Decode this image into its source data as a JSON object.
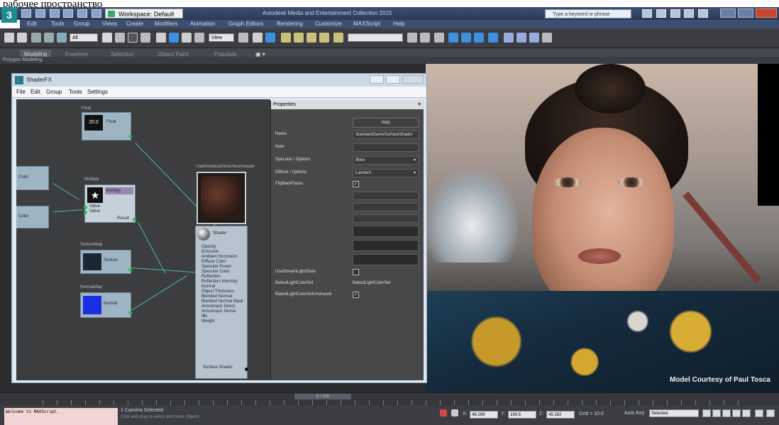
{
  "top_text": "рабочее пространство",
  "titlebar": {
    "workspace_label": "Workspace: Default",
    "app_title": "Autodesk Media and Entertainment Collection 2015",
    "search_placeholder": "Type a keyword or phrase"
  },
  "menu": [
    "Edit",
    "Tools",
    "Group",
    "Views",
    "Create",
    "Modifiers",
    "Animation",
    "Graph Editors",
    "Rendering",
    "Customize",
    "MAXScript",
    "Help"
  ],
  "ribbon": {
    "tabs": [
      "Modeling",
      "Freeform",
      "Selection",
      "Object Paint",
      "Populate"
    ],
    "sub": "Polygon Modeling"
  },
  "toolbar": {
    "filter_value": "All",
    "view_value": "View"
  },
  "shaderfx": {
    "title": "ShaderFX",
    "menu": [
      "File",
      "Edit",
      "Group",
      "Tools",
      "Settings"
    ],
    "properties_title": "Properties",
    "help_label": "Help",
    "properties": [
      {
        "label": "Name",
        "value": "StandardGameSurfaceShader",
        "state": "text"
      },
      {
        "label": "Note",
        "value": "",
        "state": "text"
      },
      {
        "label": "Specular / Options",
        "value": "Blinn",
        "state": "dropdown"
      },
      {
        "label": "Diffuse / Options",
        "value": "Lambert",
        "state": "dropdown"
      },
      {
        "label": "FlipBackFaces",
        "value": "✓",
        "state": "check"
      },
      {
        "label": "",
        "value": "",
        "state": "disabled"
      },
      {
        "label": "",
        "value": "",
        "state": "disabled"
      },
      {
        "label": "",
        "value": "",
        "state": "disabled"
      },
      {
        "label": "",
        "value": "",
        "state": "dark"
      },
      {
        "label": "",
        "value": "",
        "state": "dark"
      },
      {
        "label": "",
        "value": "",
        "state": "dark"
      },
      {
        "label": "UseStreamLightState",
        "value": "",
        "state": "check-empty"
      },
      {
        "label": "BakedLightColorSet",
        "value": "BakedLightColorSet",
        "state": "plain"
      },
      {
        "label": "BakedLightColorSetUnshared",
        "value": "✓",
        "state": "check"
      }
    ],
    "nodes": {
      "float_title": "Float",
      "float_label": "Float",
      "float_value": "20.0",
      "mul_title": "Multiply",
      "mul_inputs": [
        "Value",
        "Value"
      ],
      "mul_out": "Result",
      "color_a": "Color",
      "color_b": "Color",
      "tex_title": "TextureMap",
      "tex_label": "Texture",
      "norm_title": "NormalMap",
      "norm_label": "Normal",
      "surface_title": "TraditionalGameSurfaceShader",
      "surface_out": "Surface Shader",
      "surface_node_label": "Shader",
      "surface_inputs": [
        "Opacity",
        "Emissive",
        "Ambient Occlusion",
        "Diffuse Color",
        "Specular Power",
        "Specular Color",
        "Reflection",
        "Reflection Intensity",
        "Normal",
        "Object Thickness",
        "Blended Normal",
        "Blended Normal Mask",
        "Anisotropic Direct.",
        "Anisotropic Sense",
        "IBL",
        "Weight"
      ]
    }
  },
  "viewport": {
    "credit": "Model Courtesy of Paul Tosca"
  },
  "timeline": {
    "frame": "0 / 100"
  },
  "status": {
    "maxscript": "Welcome to MAXScript.",
    "selected": "1 Camera Selected",
    "prompt": "Click and drag to select and move objects",
    "x_label": "X:",
    "x": "48.299",
    "y_label": "Y:",
    "y": "199.5",
    "z_label": "Z:",
    "z": "45.282",
    "grid": "Grid = 10.0",
    "auto_key": "Auto Key",
    "selection": "Selected"
  }
}
